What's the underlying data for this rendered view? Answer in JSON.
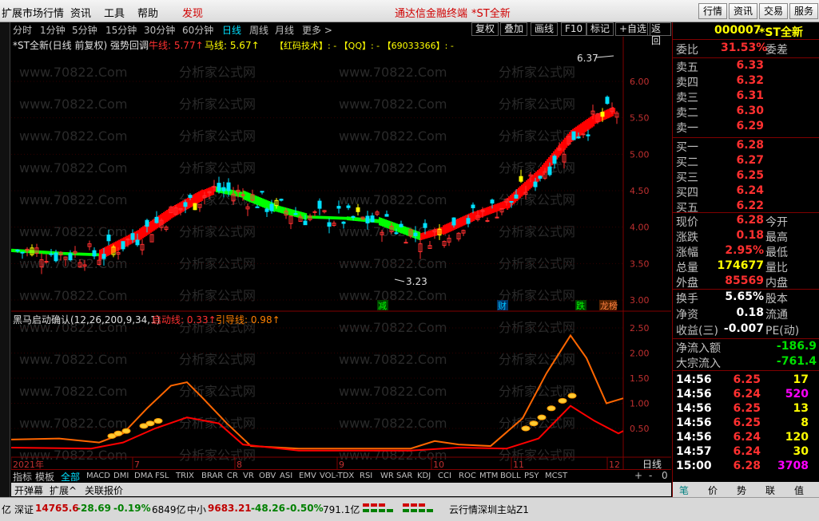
{
  "menu": {
    "items": [
      "扩展市场行情",
      "资讯",
      "工具",
      "帮助",
      "发现"
    ],
    "center_text": "通达信金融终端",
    "center_stock": "*ST全新",
    "right_buttons": [
      "行情",
      "资讯",
      "交易",
      "服务"
    ]
  },
  "toolbar": {
    "periods": [
      "分时",
      "1分钟",
      "5分钟",
      "15分钟",
      "30分钟",
      "60分钟",
      "日线",
      "周线",
      "月线",
      "更多 >"
    ],
    "active_period": "日线",
    "right_buttons": [
      "复权",
      "叠加",
      "画线",
      "F10",
      "标记",
      "+自选",
      "返回"
    ]
  },
  "main_chart": {
    "info_title": "*ST全新(日线 前复权) 强势回调",
    "niu_label": "牛线: 5.77↑",
    "ma_label": "马线: 5.67↑",
    "extra_label": "【红码技术】: -  【QQ】: -  【69033366】: -",
    "watermark": "www.70822.Com",
    "watermark2": "分析家公式网",
    "y_ticks": [
      "6.00",
      "5.50",
      "5.00",
      "4.50",
      "4.00",
      "3.50",
      "3.00"
    ],
    "y_values": [
      6.0,
      5.5,
      5.0,
      4.5,
      4.0,
      3.5,
      3.0
    ],
    "high_marker": "6.37",
    "low_marker": "3.23",
    "event_labels": [
      "减",
      "财",
      "跌",
      "龙榜"
    ]
  },
  "indicator": {
    "title": "黑马启动确认(12,26,200,9,34,1)",
    "start_label": "启动线: 0.33↑",
    "guide_label": "引导线: 0.98↑",
    "y_ticks": [
      "2.50",
      "2.00",
      "1.50",
      "1.00",
      "0.50"
    ],
    "y_values": [
      2.5,
      2.0,
      1.5,
      1.0,
      0.5
    ]
  },
  "x_axis": {
    "labels": [
      "2021年",
      "7",
      "8",
      "9",
      "10",
      "11",
      "12"
    ],
    "period": "日线"
  },
  "bottom_tabs": [
    "指标",
    "模板",
    "全部",
    "MACD",
    "DMI",
    "DMA",
    "FSL",
    "TRIX",
    "BRAR",
    "CR",
    "VR",
    "OBV",
    "ASI",
    "EMV",
    "VOL-TDX",
    "RSI",
    "WR",
    "SAR",
    "KDJ",
    "CCI",
    "ROC",
    "MTM",
    "BOLL",
    "PSY",
    "MCST"
  ],
  "bottom_active": "全部",
  "bottom_nav": [
    "+",
    "-",
    "0"
  ],
  "sub_tabs": [
    "开弹幕",
    "扩展^",
    "关联报价"
  ],
  "right_panel": {
    "code": "000007",
    "name": "*ST全新",
    "weibi_label": "委比",
    "weibi_value": "31.53%",
    "weicha_label": "委差",
    "sell": [
      {
        "label": "卖五",
        "price": "6.33"
      },
      {
        "label": "卖四",
        "price": "6.32"
      },
      {
        "label": "卖三",
        "price": "6.31"
      },
      {
        "label": "卖二",
        "price": "6.30"
      },
      {
        "label": "卖一",
        "price": "6.29"
      }
    ],
    "buy": [
      {
        "label": "买一",
        "price": "6.28"
      },
      {
        "label": "买二",
        "price": "6.27"
      },
      {
        "label": "买三",
        "price": "6.25"
      },
      {
        "label": "买四",
        "price": "6.24"
      },
      {
        "label": "买五",
        "price": "6.22"
      }
    ],
    "stats": [
      {
        "l1": "现价",
        "v": "6.28",
        "cls": "red",
        "l2": "今开"
      },
      {
        "l1": "涨跌",
        "v": "0.18",
        "cls": "red",
        "l2": "最高"
      },
      {
        "l1": "涨幅",
        "v": "2.95%",
        "cls": "red",
        "l2": "最低"
      },
      {
        "l1": "总量",
        "v": "174677",
        "cls": "yellow",
        "l2": "量比"
      },
      {
        "l1": "外盘",
        "v": "85569",
        "cls": "red",
        "l2": "内盘"
      }
    ],
    "stats2": [
      {
        "l1": "换手",
        "v": "5.65%",
        "cls": "white",
        "l2": "股本"
      },
      {
        "l1": "净资",
        "v": "0.18",
        "cls": "white",
        "l2": "流通"
      },
      {
        "l1": "收益(三)",
        "v": "-0.007",
        "cls": "white",
        "l2": "PE(动)"
      }
    ],
    "flow": [
      {
        "label": "净流入额",
        "v": "-186.9"
      },
      {
        "label": "大宗流入",
        "v": "-761.4"
      }
    ],
    "ticks": [
      {
        "t": "14:56",
        "p": "6.25",
        "v": "17",
        "vc": "yellow"
      },
      {
        "t": "14:56",
        "p": "6.24",
        "v": "520",
        "vc": "mag"
      },
      {
        "t": "14:56",
        "p": "6.25",
        "v": "13",
        "vc": "yellow"
      },
      {
        "t": "14:56",
        "p": "6.25",
        "v": "8",
        "vc": "yellow"
      },
      {
        "t": "14:56",
        "p": "6.24",
        "v": "120",
        "vc": "yellow"
      },
      {
        "t": "14:57",
        "p": "6.24",
        "v": "30",
        "vc": "yellow"
      },
      {
        "t": "15:00",
        "p": "6.28",
        "v": "3708",
        "vc": "mag"
      }
    ],
    "tabs": [
      "笔",
      "价",
      "势",
      "联",
      "值"
    ]
  },
  "status": {
    "prefix": "亿",
    "index_name": "深证",
    "index_value": "14765.6",
    "index_change": "-28.69",
    "index_pct": "-0.19%",
    "index_amount": "6849亿",
    "index2_name": "中小",
    "index2_value": "9683.21",
    "index2_change": "-48.26",
    "index2_pct": "-0.50%",
    "index2_amount": "791.1亿",
    "server": "云行情深圳主站Z1"
  },
  "colors": {
    "rise": "#ff3030",
    "fall": "#00e000",
    "band_up": "#ff0000",
    "band_down": "#00ff00",
    "line_orange": "#ff6600",
    "line_red": "#ff0000",
    "highlight_yellow": "#ffff00",
    "cyan_candle": "#00e0ff"
  }
}
